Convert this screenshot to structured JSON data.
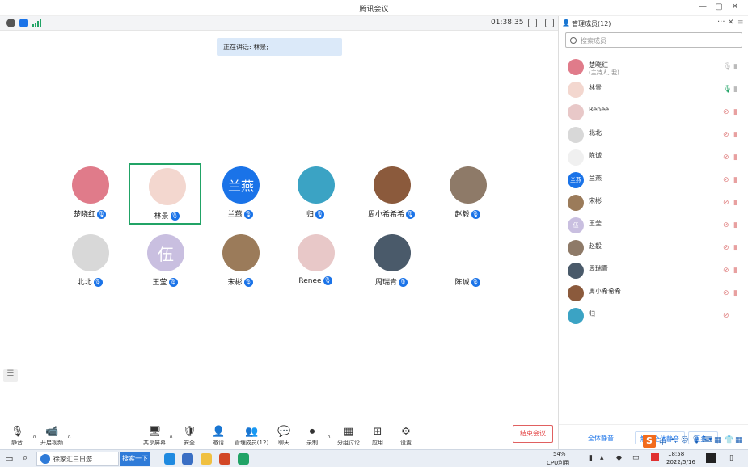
{
  "window": {
    "title": "腾讯会议",
    "min": "—",
    "max": "▢",
    "close": "✕"
  },
  "status": {
    "timer": "01:38:35"
  },
  "speaking": "正在讲话: 林景;",
  "participants": [
    {
      "name": "楚晓红",
      "color": "#e07b8a",
      "avatar_text": ""
    },
    {
      "name": "林景",
      "color": "#f3d7cf",
      "avatar_text": "",
      "active": true
    },
    {
      "name": "兰燕",
      "color": "#1a73e8",
      "avatar_text": "兰燕"
    },
    {
      "name": "归",
      "color": "#3ba3c4",
      "avatar_text": ""
    },
    {
      "name": "周小希希希",
      "color": "#8b5a3c",
      "avatar_text": ""
    },
    {
      "name": "赵毅",
      "color": "#8e7a68",
      "avatar_text": ""
    },
    {
      "name": "北北",
      "color": "#d8d8d8",
      "avatar_text": ""
    },
    {
      "name": "王莹",
      "color": "#c9bfe0",
      "avatar_text": "伍"
    },
    {
      "name": "宋彬",
      "color": "#9b7b5a",
      "avatar_text": ""
    },
    {
      "name": "Renee",
      "color": "#e8c8c8",
      "avatar_text": ""
    },
    {
      "name": "周瑞青",
      "color": "#4a5a6a",
      "avatar_text": ""
    },
    {
      "name": "陈诚",
      "color": "#ffffff",
      "avatar_text": ""
    }
  ],
  "panel": {
    "title": "管理成员(12)",
    "search_placeholder": "搜索成员",
    "members": [
      {
        "name": "楚晓红",
        "sub": "(主持人, 我)",
        "color": "#e07b8a",
        "mic_on": true
      },
      {
        "name": "林景",
        "sub": "",
        "color": "#f3d7cf",
        "mic_on": true,
        "speaking": true
      },
      {
        "name": "Renee",
        "sub": "",
        "color": "#e8c8c8",
        "mic_on": false
      },
      {
        "name": "北北",
        "sub": "",
        "color": "#d8d8d8",
        "mic_on": false
      },
      {
        "name": "陈诚",
        "sub": "",
        "color": "#f0f0f0",
        "mic_on": false
      },
      {
        "name": "兰燕",
        "sub": "",
        "color": "#1a73e8",
        "mic_on": false,
        "avatar_text": "兰燕"
      },
      {
        "name": "宋彬",
        "sub": "",
        "color": "#9b7b5a",
        "mic_on": false
      },
      {
        "name": "王莹",
        "sub": "",
        "color": "#c9bfe0",
        "mic_on": false,
        "avatar_text": "伍"
      },
      {
        "name": "赵毅",
        "sub": "",
        "color": "#8e7a68",
        "mic_on": false
      },
      {
        "name": "周瑞青",
        "sub": "",
        "color": "#4a5a6a",
        "mic_on": false
      },
      {
        "name": "周小希希希",
        "sub": "",
        "color": "#8b5a3c",
        "mic_on": false
      },
      {
        "name": "归",
        "sub": "",
        "color": "#3ba3c4",
        "mic_on": false
      }
    ],
    "footer": {
      "mute_all": "全体静音",
      "unmute_all": "解除全体静音",
      "more": "更多 ▾"
    }
  },
  "toolbar": {
    "items": [
      {
        "label": "静音",
        "icon": "🎙"
      },
      {
        "label": "开启视频",
        "icon": "📹"
      },
      {
        "label": "共享屏幕",
        "icon": "🖥"
      },
      {
        "label": "安全",
        "icon": "🛡"
      },
      {
        "label": "邀请",
        "icon": "👤"
      },
      {
        "label": "管理成员(12)",
        "icon": "👥"
      },
      {
        "label": "聊天",
        "icon": "💬"
      },
      {
        "label": "录制",
        "icon": "⏺"
      },
      {
        "label": "分组讨论",
        "icon": "▦"
      },
      {
        "label": "应用",
        "icon": "⊞"
      },
      {
        "label": "设置",
        "icon": "⚙"
      }
    ],
    "end": "结束会议"
  },
  "taskbar": {
    "search_text": "徐家汇三日游",
    "search_btn": "搜索一下",
    "cpu": "54%",
    "cpu_label": "CPU利用",
    "time": "18:58",
    "date": "2022/5/16"
  },
  "ime": {
    "zh": "中"
  }
}
